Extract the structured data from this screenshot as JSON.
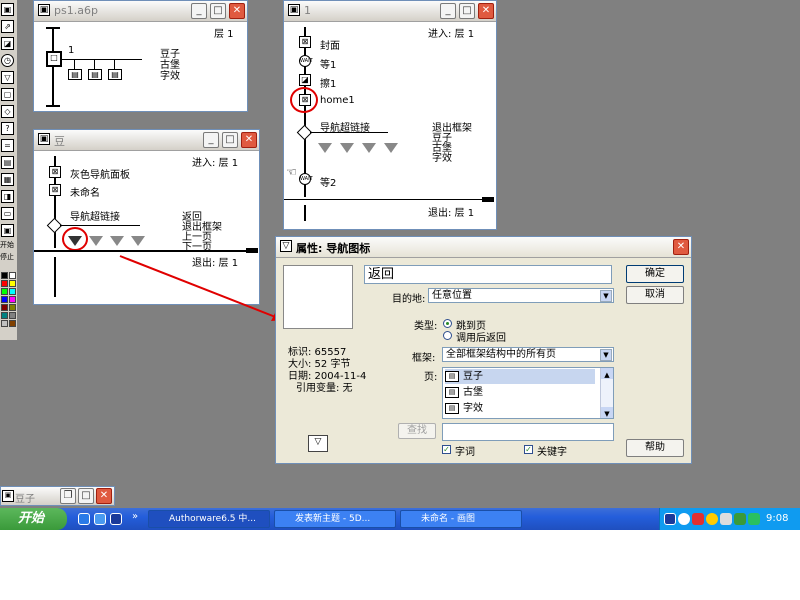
{
  "colors": {
    "desktop": "#808080",
    "taskbar": "#245edb",
    "start": "#3a9a3a",
    "accent_red": "#e00000",
    "dialog_bg": "#ece9d8"
  },
  "win_ps1": {
    "title": "ps1.a6p",
    "level": "层 1",
    "icon_name": "1",
    "branches": [
      "豆子",
      "古堡",
      "字效"
    ]
  },
  "win_one": {
    "title": "1",
    "enter": "进入: 层 1",
    "exit": "退出: 层 1",
    "icons": [
      "封面",
      "等1",
      "擦1",
      "home1",
      "导航超链接",
      "等2"
    ],
    "branch_labels": [
      "退出框架",
      "豆子",
      "古堡",
      "字效"
    ],
    "wait_glyph": "WAIT"
  },
  "win_dou": {
    "title": "豆",
    "enter": "进入: 层 1",
    "exit": "退出: 层 1",
    "icons": [
      "灰色导航面板",
      "未命名",
      "导航超链接"
    ],
    "branch_labels": [
      "返回",
      "退出框架",
      "上一页",
      "下一页"
    ]
  },
  "dialog": {
    "title": "属性: 导航图标",
    "name_value": "返回",
    "dest_label": "目的地:",
    "dest_value": "任意位置",
    "type_label": "类型:",
    "radio_jump": "跳到页",
    "radio_call": "调用后返回",
    "frame_label": "框架:",
    "frame_value": "全部框架结构中的所有页",
    "page_label": "页:",
    "pages": [
      "豆子",
      "古堡",
      "字效"
    ],
    "find_btn": "查找",
    "chk_word": "字词",
    "chk_key": "关键字",
    "info": {
      "id": "标识: 65557",
      "size": "大小: 52 字节",
      "date": "日期: 2004-11-4",
      "ref": "引用变量: 无"
    },
    "ok": "确定",
    "cancel": "取消",
    "help": "帮助"
  },
  "min_win": {
    "title": "豆子"
  },
  "left_toolbar": {
    "label1": "开始",
    "label2": "停止"
  },
  "taskbar": {
    "start": "开始",
    "chevron": "»",
    "items": [
      "Authorware6.5 中...",
      "发表新主题 - 5D...",
      "未命名 - 画图"
    ],
    "time": "9:08"
  }
}
